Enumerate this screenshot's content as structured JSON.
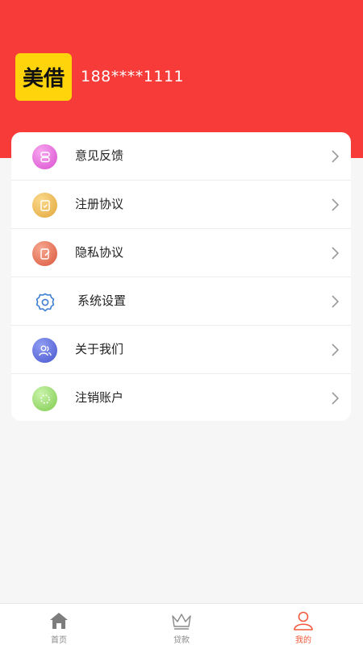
{
  "header": {
    "logo_text": "美借",
    "phone": "188****1111",
    "background": "#f73b39",
    "logo_color": "#ffd40b"
  },
  "menu": {
    "items": [
      {
        "label": "意见反馈",
        "icon": "feedback-icon",
        "color": "#e05fd6"
      },
      {
        "label": "注册协议",
        "icon": "register-agreement-icon",
        "color": "#e9b84f"
      },
      {
        "label": "隐私协议",
        "icon": "privacy-agreement-icon",
        "color": "#e8735a"
      },
      {
        "label": "系统设置",
        "icon": "gear-icon",
        "color": "#3d7fd1"
      },
      {
        "label": "关于我们",
        "icon": "users-icon",
        "color": "#5466d8"
      },
      {
        "label": "注销账户",
        "icon": "cancel-account-icon",
        "color": "#8bd95e"
      }
    ]
  },
  "tabbar": {
    "tabs": [
      {
        "label": "首页",
        "icon": "home-icon"
      },
      {
        "label": "贷款",
        "icon": "crown-icon"
      },
      {
        "label": "我的",
        "icon": "person-icon",
        "active": true
      }
    ],
    "active_color": "#f05a3a"
  }
}
